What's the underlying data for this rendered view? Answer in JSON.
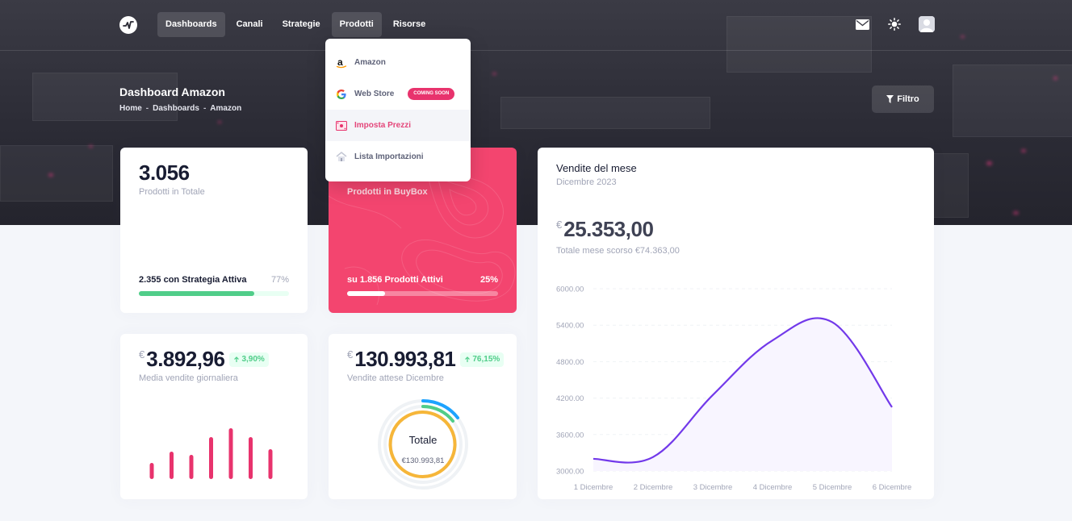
{
  "nav": {
    "items": [
      "Dashboards",
      "Canali",
      "Strategie",
      "Prodotti",
      "Risorse"
    ],
    "active": "Dashboards",
    "open": "Prodotti"
  },
  "dropdown": {
    "items": [
      {
        "label": "Amazon",
        "icon": "amazon-icon"
      },
      {
        "label": "Web Store",
        "icon": "google-icon",
        "badge": "COMING SOON"
      },
      {
        "label": "Imposta Prezzi",
        "icon": "price-tag-icon"
      },
      {
        "label": "Lista Importazioni",
        "icon": "import-icon"
      }
    ],
    "active_index": 2
  },
  "header": {
    "title": "Dashboard Amazon",
    "breadcrumb": [
      "Home",
      "Dashboards",
      "Amazon"
    ],
    "filter_label": "Filtro"
  },
  "cards": {
    "products_total": {
      "value": "3.056",
      "label": "Prodotti in Totale",
      "progress_label": "2.355 con Strategia Attiva",
      "progress_pct_label": "77%",
      "progress": 0.77
    },
    "buybox": {
      "label": "Prodotti in BuyBox",
      "progress_label": "su 1.856 Prodotti Attivi",
      "progress_pct_label": "25%",
      "progress": 0.25
    },
    "daily_avg": {
      "currency": "€",
      "value": "3.892,96",
      "change": "3,90%",
      "label": "Media vendite giornaliera",
      "bars": [
        2,
        3.4,
        3,
        5.2,
        6.3,
        5.2,
        3.7
      ]
    },
    "expected": {
      "currency": "€",
      "value": "130.993,81",
      "change": "76,15%",
      "label": "Vendite attese Dicembre",
      "donut_title": "Totale",
      "donut_value": "€130.993,81"
    },
    "monthly": {
      "title": "Vendite del mese",
      "subtitle": "Dicembre 2023",
      "currency": "€",
      "value": "25.353,00",
      "previous": "Totale mese scorso €74.363,00"
    }
  },
  "colors": {
    "accent": "#e8336d",
    "buybox": "#f3456f",
    "success": "#50cd89",
    "line": "#7239ea",
    "donut_orange": "#f6b639",
    "donut_green": "#50cd89",
    "donut_blue": "#1da3ff"
  },
  "chart_data": {
    "type": "area",
    "categories": [
      "1 Dicembre",
      "2 Dicembre",
      "3 Dicembre",
      "4 Dicembre",
      "5 Dicembre",
      "6 Dicembre"
    ],
    "values": [
      3200,
      3230,
      4250,
      5150,
      5450,
      4050
    ],
    "yticks": [
      "6000.00",
      "5400.00",
      "4800.00",
      "4200.00",
      "3600.00",
      "3000.00"
    ],
    "ylim": [
      3000,
      6000
    ],
    "grid": true
  }
}
